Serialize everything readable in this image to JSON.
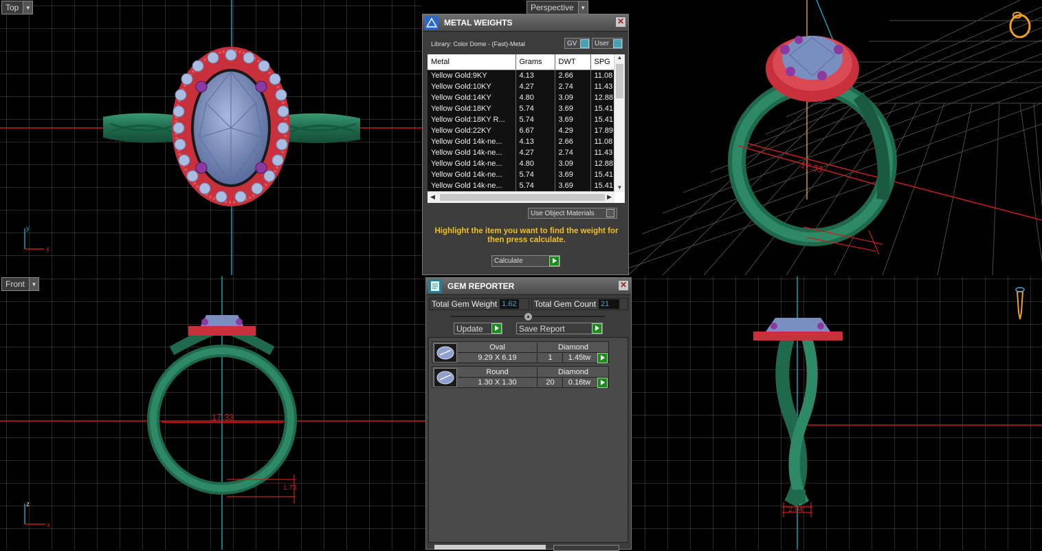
{
  "viewports": {
    "top": "Top",
    "perspective": "Perspective",
    "front": "Front"
  },
  "dimensions": {
    "front_diameter": "17.33",
    "persp_diameter": "17.33",
    "front_small": "1.73",
    "side_width": "2.04"
  },
  "metal_weights": {
    "title": "METAL WEIGHTS",
    "library": "Library: Color Dome - (Fast)-Metal",
    "gv_label": "GV",
    "user_label": "User",
    "columns": [
      "Metal",
      "Grams",
      "DWT",
      "SPG"
    ],
    "rows": [
      [
        "Yellow Gold:9KY",
        "4.13",
        "2.66",
        "11.08"
      ],
      [
        "Yellow Gold:10KY",
        "4.27",
        "2.74",
        "11.43"
      ],
      [
        "Yellow Gold:14KY",
        "4.80",
        "3.09",
        "12.88"
      ],
      [
        "Yellow Gold:18KY",
        "5.74",
        "3.69",
        "15.41"
      ],
      [
        "Yellow Gold:18KY R...",
        "5.74",
        "3.69",
        "15.41"
      ],
      [
        "Yellow Gold:22KY",
        "6.67",
        "4.29",
        "17.89"
      ],
      [
        "Yellow Gold 14k-ne...",
        "4.13",
        "2.66",
        "11.08"
      ],
      [
        "Yellow Gold 14k-ne...",
        "4.27",
        "2.74",
        "11.43"
      ],
      [
        "Yellow Gold 14k-ne...",
        "4.80",
        "3.09",
        "12.88"
      ],
      [
        "Yellow Gold 14k-ne...",
        "5.74",
        "3.69",
        "15.41"
      ],
      [
        "Yellow Gold 14k-ne...",
        "5.74",
        "3.69",
        "15.41"
      ]
    ],
    "use_object_materials": "Use Object Materials",
    "instruction": "Highlight the item you want to find the weight for then press calculate.",
    "calculate": "Calculate"
  },
  "gem_reporter": {
    "title": "GEM REPORTER",
    "total_weight_label": "Total Gem Weight",
    "total_weight": "1.62",
    "total_count_label": "Total Gem Count",
    "total_count": "21",
    "update": "Update",
    "save_report": "Save Report",
    "gems": [
      {
        "shape": "Oval",
        "material": "Diamond",
        "size": "9.29 X 6.19",
        "count": "1",
        "weight": "1.45tw"
      },
      {
        "shape": "Round",
        "material": "Diamond",
        "size": "1.30 X 1.30",
        "count": "20",
        "weight": "0.16tw"
      }
    ]
  },
  "colors": {
    "band": "#2a7a5c",
    "halo": "#d8404c",
    "stone": "#7a8fc0",
    "prong": "#8a3aa0",
    "grid": "#555555",
    "axis_red": "#c81e1e",
    "axis_cyan": "#1aa0b8",
    "accent_text": "#f0c020"
  }
}
